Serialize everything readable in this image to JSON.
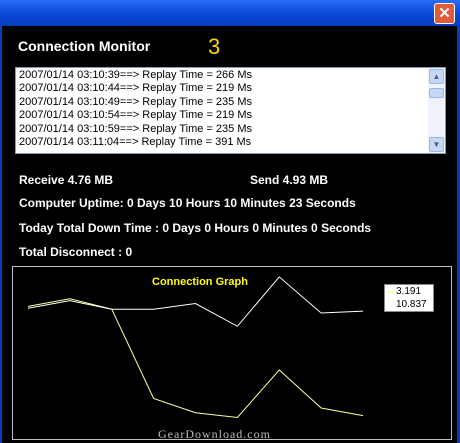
{
  "window": {
    "title": "Connection Monitor",
    "disconnect_count": "3",
    "close_glyph": "✕"
  },
  "log": {
    "lines": [
      "2007/01/14 03:10:39==> Replay Time = 266 Ms",
      "2007/01/14 03:10:44==> Replay Time = 219 Ms",
      "2007/01/14 03:10:49==> Replay Time = 235 Ms",
      "2007/01/14 03:10:54==> Replay Time = 219 Ms",
      "2007/01/14 03:10:59==> Replay Time = 235 Ms",
      "2007/01/14 03:11:04==> Replay Time = 391 Ms"
    ]
  },
  "stats": {
    "receive": "Receive 4.76 MB",
    "send": "Send 4.93 MB",
    "uptime": "Computer Uptime: 0 Days 10 Hours 10 Minutes 23 Seconds",
    "downtime": "Today Total Down Time : 0 Days 0 Hours 0 Minutes 0 Seconds",
    "disconnects": "Total Disconnect : 0"
  },
  "colors": {
    "series_1": "#ffffa0",
    "series_2": "#ffffff",
    "graph_title": "#ffff00"
  },
  "chart_data": {
    "type": "line",
    "title": "Connection Graph",
    "x": [
      1,
      2,
      3,
      4,
      5,
      6,
      7,
      8,
      9
    ],
    "ylim": [
      0,
      16
    ],
    "series": [
      {
        "name": "3.191",
        "values": [
          12.7,
          13.5,
          12.4,
          3.0,
          1.5,
          1.0,
          6.0,
          2.0,
          1.2
        ]
      },
      {
        "name": "10.837",
        "values": [
          12.5,
          13.3,
          12.4,
          12.4,
          13.0,
          10.6,
          15.8,
          12.0,
          12.2
        ]
      }
    ]
  },
  "watermark": "GearDownload.com"
}
